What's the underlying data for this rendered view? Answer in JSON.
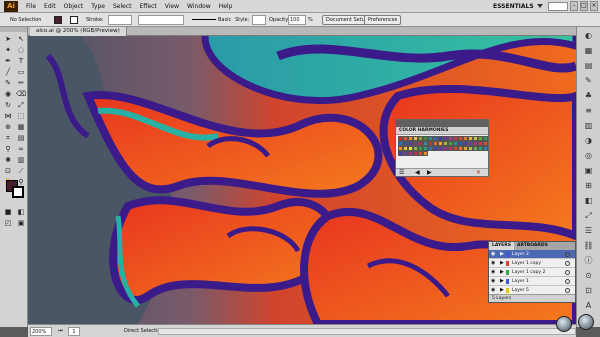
{
  "app": {
    "logo_text": "Ai",
    "menu": [
      "File",
      "Edit",
      "Object",
      "Type",
      "Select",
      "Effect",
      "View",
      "Window",
      "Help"
    ],
    "workspace": "ESSENTIALS"
  },
  "control_bar": {
    "selection": "No Selection",
    "stroke_label": "Stroke:",
    "basic_label": "Basic",
    "style_label": "Style:",
    "opacity_label": "Opacity:",
    "opacity_value": "100",
    "opacity_unit": "%",
    "doc_setup": "Document Setup",
    "preferences": "Preferences",
    "fill_color": "#45202a"
  },
  "document": {
    "tab_title": "alco.ai @ 200% (RGB/Preview)"
  },
  "color_harmonies": {
    "title": "COLOR HARMONIES",
    "swatches": [
      "#c2302a",
      "#e0582c",
      "#f0902e",
      "#f4c030",
      "#8aa030",
      "#3f8f3c",
      "#2a8f8a",
      "#2b6fb0",
      "#3a3f9a",
      "#6b3a9a",
      "#a33a8a",
      "#c8344f",
      "#d04a2a",
      "#e27a2a",
      "#f0b030",
      "#c8c83a",
      "#6aa83a",
      "#2f9a6a",
      "#2a7ab0",
      "#3a4fa8",
      "#5a3a9a",
      "#8a3a8a",
      "#b8304a",
      "#3a8aa0",
      "#c23a2a",
      "#e06a2a",
      "#f0a02e",
      "#a8b83a",
      "#4a9a3a",
      "#2a8aa0",
      "#2a5ab0",
      "#4a3aa0",
      "#7a3a98",
      "#b0308a",
      "#d03a40",
      "#e8502a",
      "#f08a2e",
      "#f0c03a",
      "#f0e040",
      "#8fbf3a",
      "#3aa040",
      "#2aa080",
      "#2a7ac0",
      "#3a48b0",
      "#6a38a8",
      "#9a3090",
      "#c03060",
      "#e04030",
      "#f07030",
      "#e0a030",
      "#b0c040",
      "#60b040",
      "#30a070",
      "#3080b0",
      "#4040a0",
      "#7040a0",
      "#a03080",
      "#c03050",
      "#d85030",
      "#e88a30"
    ]
  },
  "layers": {
    "tabs": [
      "LAYERS",
      "ARTBOARDS"
    ],
    "rows": [
      {
        "name": "Layer 2",
        "color": "#3a58d8",
        "selected": true
      },
      {
        "name": "Layer 1 copy",
        "color": "#e03b3b",
        "selected": false
      },
      {
        "name": "Layer 1 copy 2",
        "color": "#3aa84a",
        "selected": false
      },
      {
        "name": "Layer 1",
        "color": "#3a58d8",
        "selected": false
      },
      {
        "name": "Layer 5",
        "color": "#e0c030",
        "selected": false
      }
    ],
    "count_label": "5 Layers"
  },
  "status": {
    "zoom": "200%",
    "page": "1",
    "tool": "Direct Selection"
  },
  "colors": {
    "canvas_left": "#4a5566",
    "purple_outline": "#3b1a8a",
    "red": "#e8351f",
    "orange": "#f0621e",
    "teal": "#27b0a4"
  }
}
